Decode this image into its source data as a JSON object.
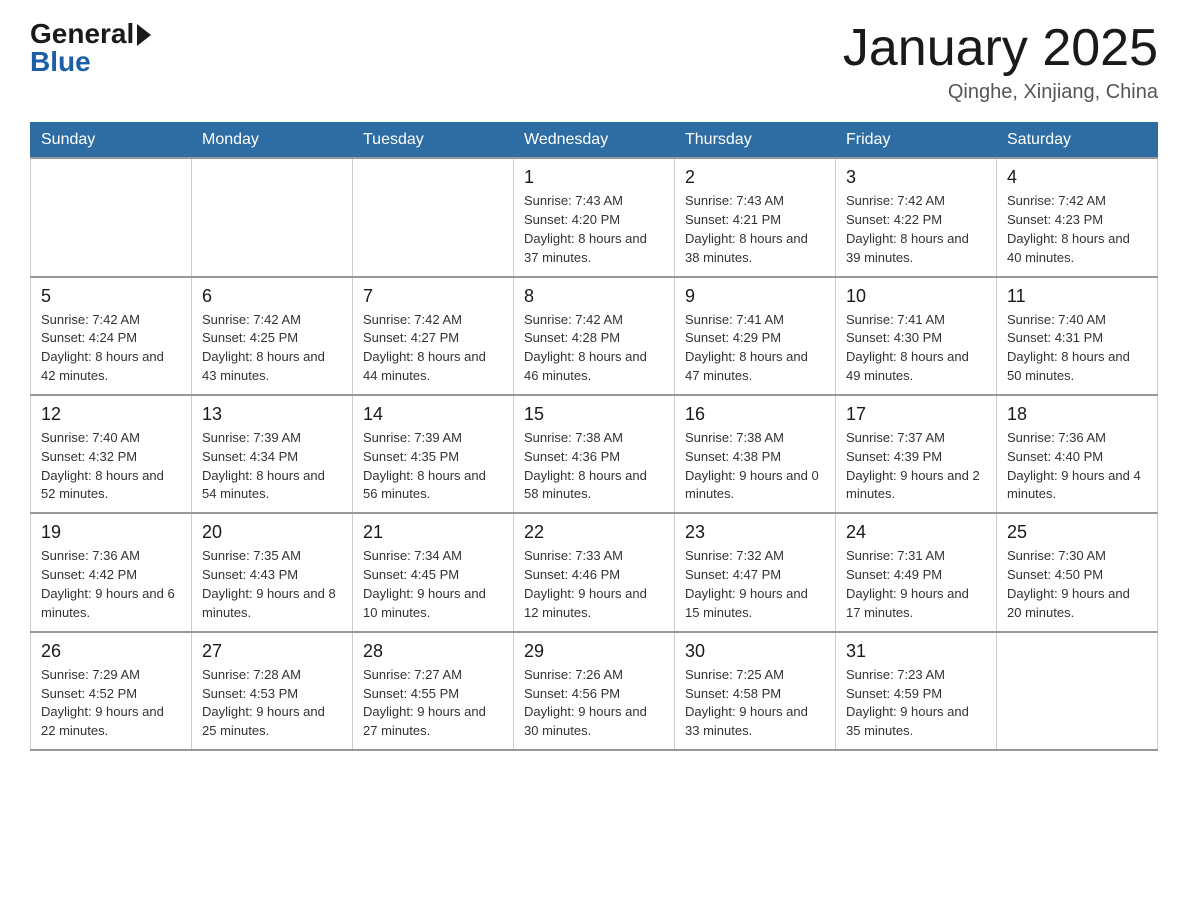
{
  "header": {
    "logo_general": "General",
    "logo_blue": "Blue",
    "month_title": "January 2025",
    "location": "Qinghe, Xinjiang, China"
  },
  "days_of_week": [
    "Sunday",
    "Monday",
    "Tuesday",
    "Wednesday",
    "Thursday",
    "Friday",
    "Saturday"
  ],
  "weeks": [
    [
      {
        "day": "",
        "info": ""
      },
      {
        "day": "",
        "info": ""
      },
      {
        "day": "",
        "info": ""
      },
      {
        "day": "1",
        "info": "Sunrise: 7:43 AM\nSunset: 4:20 PM\nDaylight: 8 hours\nand 37 minutes."
      },
      {
        "day": "2",
        "info": "Sunrise: 7:43 AM\nSunset: 4:21 PM\nDaylight: 8 hours\nand 38 minutes."
      },
      {
        "day": "3",
        "info": "Sunrise: 7:42 AM\nSunset: 4:22 PM\nDaylight: 8 hours\nand 39 minutes."
      },
      {
        "day": "4",
        "info": "Sunrise: 7:42 AM\nSunset: 4:23 PM\nDaylight: 8 hours\nand 40 minutes."
      }
    ],
    [
      {
        "day": "5",
        "info": "Sunrise: 7:42 AM\nSunset: 4:24 PM\nDaylight: 8 hours\nand 42 minutes."
      },
      {
        "day": "6",
        "info": "Sunrise: 7:42 AM\nSunset: 4:25 PM\nDaylight: 8 hours\nand 43 minutes."
      },
      {
        "day": "7",
        "info": "Sunrise: 7:42 AM\nSunset: 4:27 PM\nDaylight: 8 hours\nand 44 minutes."
      },
      {
        "day": "8",
        "info": "Sunrise: 7:42 AM\nSunset: 4:28 PM\nDaylight: 8 hours\nand 46 minutes."
      },
      {
        "day": "9",
        "info": "Sunrise: 7:41 AM\nSunset: 4:29 PM\nDaylight: 8 hours\nand 47 minutes."
      },
      {
        "day": "10",
        "info": "Sunrise: 7:41 AM\nSunset: 4:30 PM\nDaylight: 8 hours\nand 49 minutes."
      },
      {
        "day": "11",
        "info": "Sunrise: 7:40 AM\nSunset: 4:31 PM\nDaylight: 8 hours\nand 50 minutes."
      }
    ],
    [
      {
        "day": "12",
        "info": "Sunrise: 7:40 AM\nSunset: 4:32 PM\nDaylight: 8 hours\nand 52 minutes."
      },
      {
        "day": "13",
        "info": "Sunrise: 7:39 AM\nSunset: 4:34 PM\nDaylight: 8 hours\nand 54 minutes."
      },
      {
        "day": "14",
        "info": "Sunrise: 7:39 AM\nSunset: 4:35 PM\nDaylight: 8 hours\nand 56 minutes."
      },
      {
        "day": "15",
        "info": "Sunrise: 7:38 AM\nSunset: 4:36 PM\nDaylight: 8 hours\nand 58 minutes."
      },
      {
        "day": "16",
        "info": "Sunrise: 7:38 AM\nSunset: 4:38 PM\nDaylight: 9 hours\nand 0 minutes."
      },
      {
        "day": "17",
        "info": "Sunrise: 7:37 AM\nSunset: 4:39 PM\nDaylight: 9 hours\nand 2 minutes."
      },
      {
        "day": "18",
        "info": "Sunrise: 7:36 AM\nSunset: 4:40 PM\nDaylight: 9 hours\nand 4 minutes."
      }
    ],
    [
      {
        "day": "19",
        "info": "Sunrise: 7:36 AM\nSunset: 4:42 PM\nDaylight: 9 hours\nand 6 minutes."
      },
      {
        "day": "20",
        "info": "Sunrise: 7:35 AM\nSunset: 4:43 PM\nDaylight: 9 hours\nand 8 minutes."
      },
      {
        "day": "21",
        "info": "Sunrise: 7:34 AM\nSunset: 4:45 PM\nDaylight: 9 hours\nand 10 minutes."
      },
      {
        "day": "22",
        "info": "Sunrise: 7:33 AM\nSunset: 4:46 PM\nDaylight: 9 hours\nand 12 minutes."
      },
      {
        "day": "23",
        "info": "Sunrise: 7:32 AM\nSunset: 4:47 PM\nDaylight: 9 hours\nand 15 minutes."
      },
      {
        "day": "24",
        "info": "Sunrise: 7:31 AM\nSunset: 4:49 PM\nDaylight: 9 hours\nand 17 minutes."
      },
      {
        "day": "25",
        "info": "Sunrise: 7:30 AM\nSunset: 4:50 PM\nDaylight: 9 hours\nand 20 minutes."
      }
    ],
    [
      {
        "day": "26",
        "info": "Sunrise: 7:29 AM\nSunset: 4:52 PM\nDaylight: 9 hours\nand 22 minutes."
      },
      {
        "day": "27",
        "info": "Sunrise: 7:28 AM\nSunset: 4:53 PM\nDaylight: 9 hours\nand 25 minutes."
      },
      {
        "day": "28",
        "info": "Sunrise: 7:27 AM\nSunset: 4:55 PM\nDaylight: 9 hours\nand 27 minutes."
      },
      {
        "day": "29",
        "info": "Sunrise: 7:26 AM\nSunset: 4:56 PM\nDaylight: 9 hours\nand 30 minutes."
      },
      {
        "day": "30",
        "info": "Sunrise: 7:25 AM\nSunset: 4:58 PM\nDaylight: 9 hours\nand 33 minutes."
      },
      {
        "day": "31",
        "info": "Sunrise: 7:23 AM\nSunset: 4:59 PM\nDaylight: 9 hours\nand 35 minutes."
      },
      {
        "day": "",
        "info": ""
      }
    ]
  ]
}
